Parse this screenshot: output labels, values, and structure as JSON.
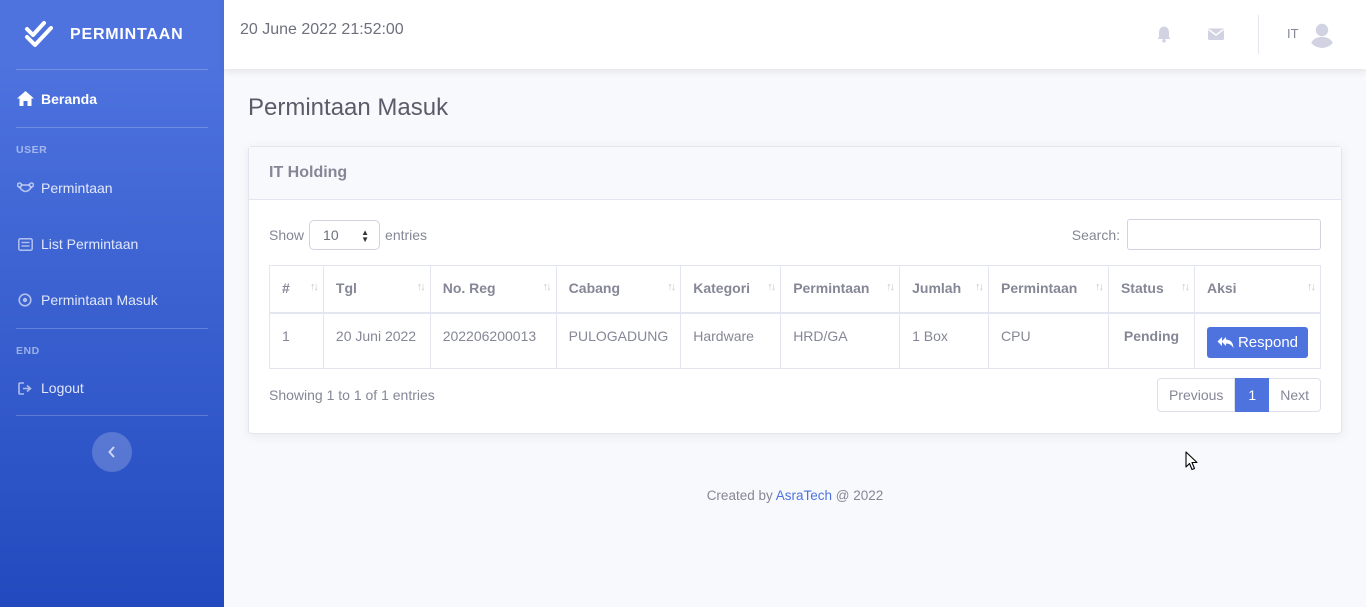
{
  "colors": {
    "primary": "#4e73df",
    "sidebar_top": "#4e73df",
    "sidebar_bottom": "#224abe"
  },
  "sidebar": {
    "brand": "PERMINTAAN",
    "brand_icon": "double-check-icon",
    "home": {
      "label": "Beranda",
      "icon": "home-icon"
    },
    "heading_user": "USER",
    "items": [
      {
        "label": "Permintaan",
        "icon": "route-icon"
      },
      {
        "label": "List Permintaan",
        "icon": "list-icon"
      },
      {
        "label": "Permintaan Masuk",
        "icon": "circle-dot-icon"
      }
    ],
    "heading_end": "END",
    "logout": {
      "label": "Logout",
      "icon": "sign-out-icon"
    },
    "toggle_icon": "chevron-left-icon"
  },
  "topbar": {
    "datetime": "20 June 2022 21:52:00",
    "user": "IT",
    "icons": [
      "bell-icon",
      "envelope-icon",
      "user-avatar-icon"
    ]
  },
  "page": {
    "title": "Permintaan Masuk"
  },
  "card": {
    "header": "IT Holding",
    "show_label": "Show",
    "entries_value": "10",
    "entries_label": "entries",
    "search_label": "Search:",
    "search_value": "",
    "columns": [
      "#",
      "Tgl",
      "No. Reg",
      "Cabang",
      "Kategori",
      "Permintaan",
      "Jumlah",
      "Permintaan",
      "Status",
      "Aksi"
    ],
    "rows": [
      {
        "no": "1",
        "tgl": "20 Juni 2022",
        "noreg": "202206200013",
        "cabang": "PULOGADUNG",
        "kategori": "Hardware",
        "permintaan": "HRD/GA",
        "jumlah": "1 Box",
        "permintaan2": "CPU",
        "status": "Pending",
        "aksi": "Respond"
      }
    ],
    "info": "Showing 1 to 1 of 1 entries",
    "pager": {
      "prev": "Previous",
      "current": "1",
      "next": "Next"
    }
  },
  "footer": {
    "prefix": "Created by",
    "link": "AsraTech",
    "suffix": "@ 2022"
  }
}
